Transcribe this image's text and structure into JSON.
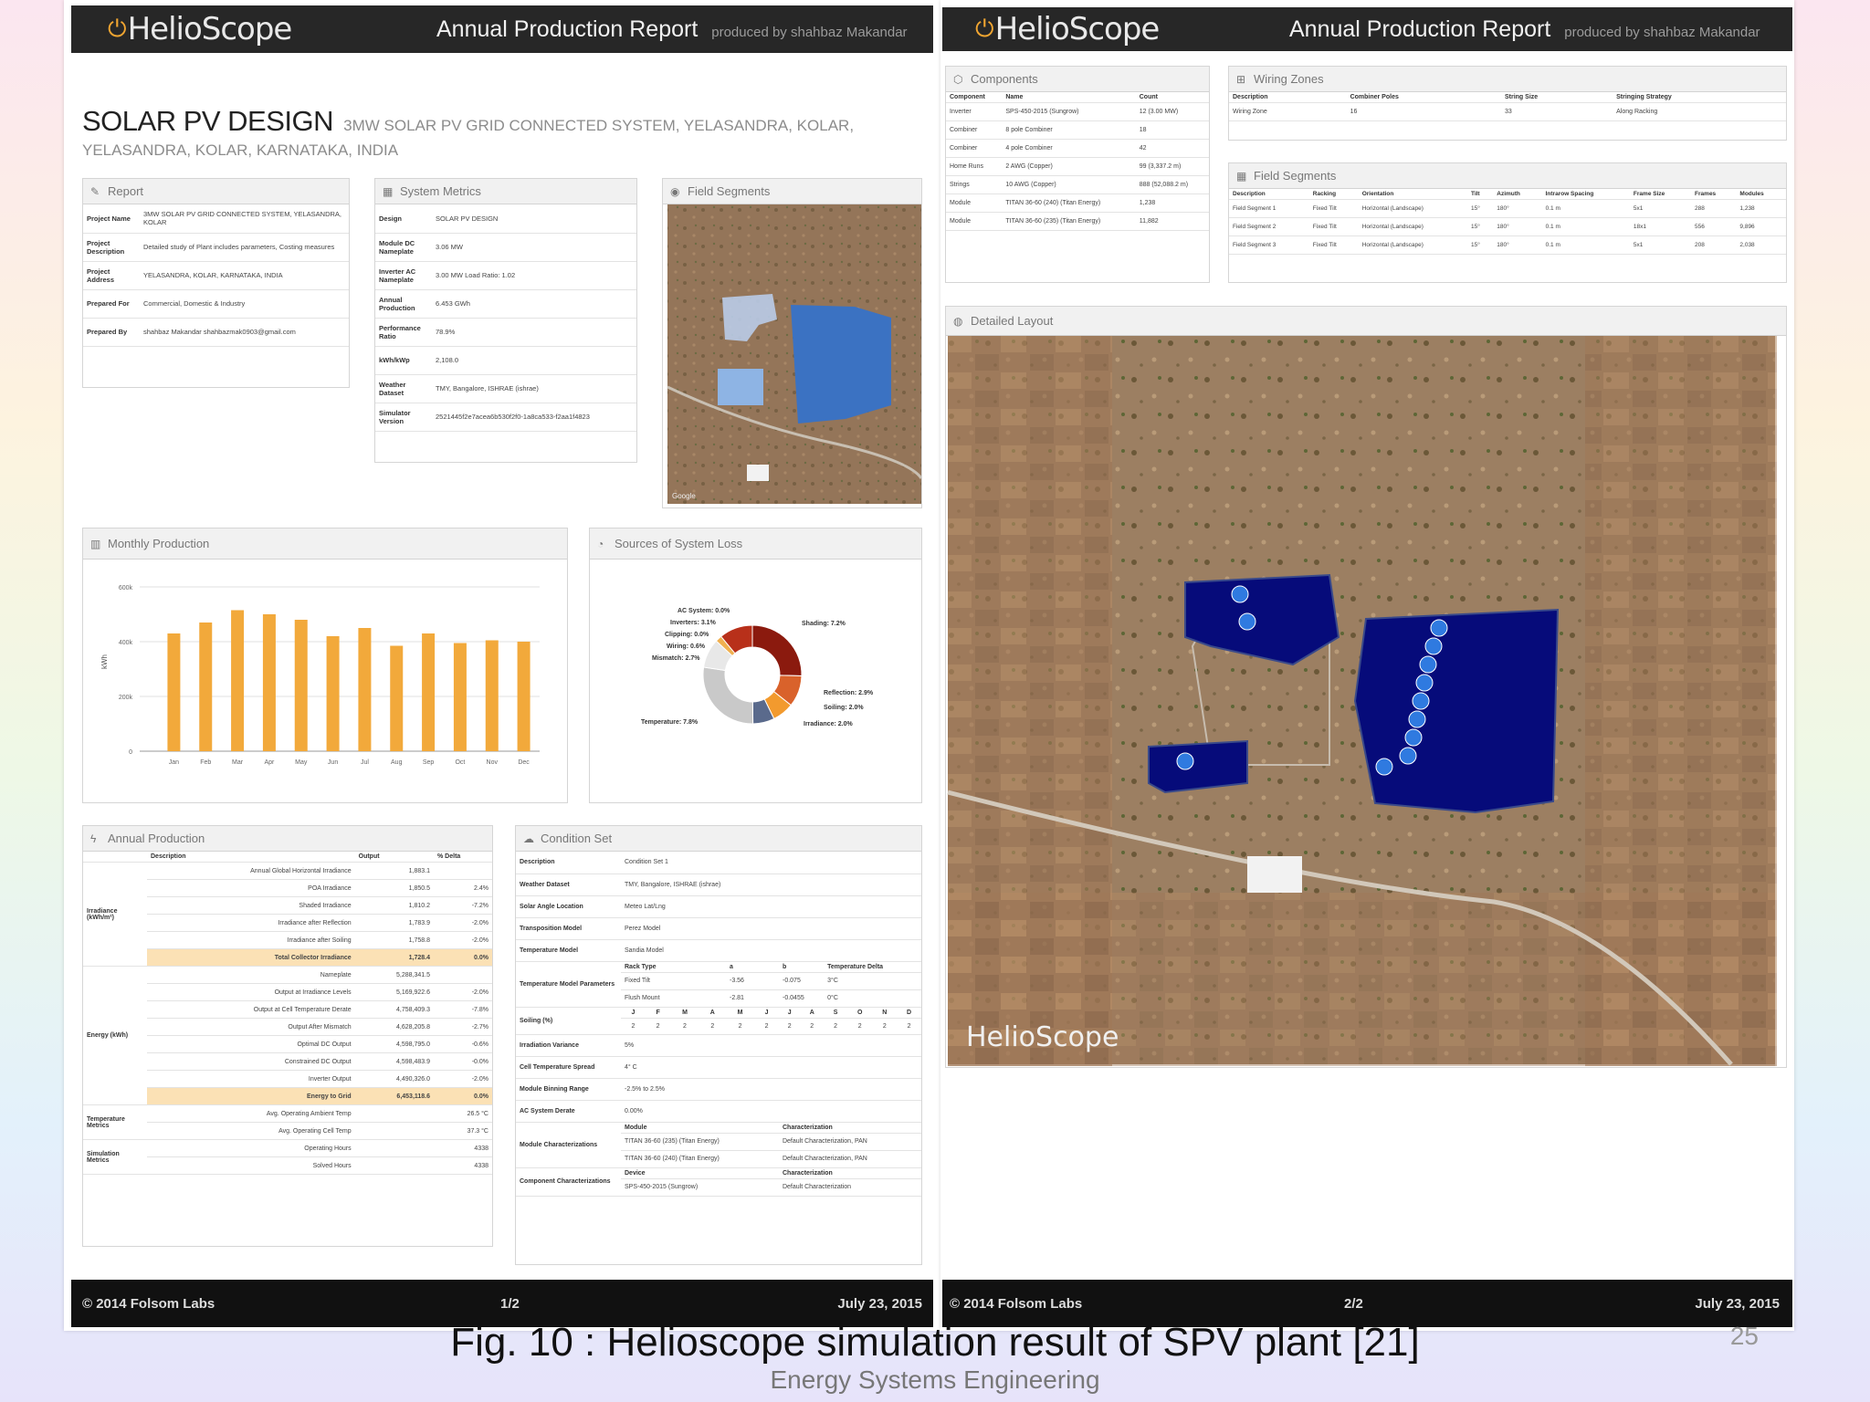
{
  "page1": {
    "header": {
      "logo": "HelioScope",
      "title": "Annual Production Report",
      "subtitle": "produced by shahbaz Makandar"
    },
    "design_title": "SOLAR PV DESIGN",
    "design_subtitle": "3MW SOLAR PV GRID CONNECTED SYSTEM, YELASANDRA, KOLAR,",
    "design_subtitle2": "YELASANDRA, KOLAR, KARNATAKA, INDIA",
    "report": {
      "heading": "Report",
      "rows": [
        {
          "k": "Project Name",
          "v": "3MW SOLAR PV GRID CONNECTED SYSTEM, YELASANDRA, KOLAR"
        },
        {
          "k": "Project Description",
          "v": "Detailed study of Plant includes parameters, Costing measures"
        },
        {
          "k": "Project Address",
          "v": "YELASANDRA, KOLAR, KARNATAKA, INDIA"
        },
        {
          "k": "Prepared For",
          "v": "Commercial, Domestic & Industry"
        },
        {
          "k": "Prepared By",
          "v": "shahbaz Makandar shahbazmak0903@gmail.com"
        }
      ]
    },
    "metrics": {
      "heading": "System Metrics",
      "rows": [
        {
          "k": "Design",
          "v": "SOLAR PV DESIGN"
        },
        {
          "k": "Module DC Nameplate",
          "v": "3.06 MW"
        },
        {
          "k": "Inverter AC Nameplate",
          "v": "3.00 MW Load Ratio: 1.02"
        },
        {
          "k": "Annual Production",
          "v": "6.453 GWh"
        },
        {
          "k": "Performance Ratio",
          "v": "78.9%"
        },
        {
          "k": "kWh/kWp",
          "v": "2,108.0"
        },
        {
          "k": "Weather Dataset",
          "v": "TMY, Bangalore, ISHRAE (ishrae)"
        },
        {
          "k": "Simulator Version",
          "v": "2521445f2e7acea6b530f2f0-1a8ca533-f2aa1f4823"
        }
      ]
    },
    "field_segments_heading": "Field Segments",
    "monthly": {
      "heading": "Monthly Production",
      "ylabel": "kWh",
      "ticks": [
        "600k",
        "400k",
        "200k",
        "0"
      ]
    },
    "losses": {
      "heading": "Sources of System Loss",
      "labels": [
        {
          "text": "AC System: 0.0%",
          "side": "left"
        },
        {
          "text": "Inverters: 3.1%",
          "side": "left"
        },
        {
          "text": "Clipping: 0.0%",
          "side": "left"
        },
        {
          "text": "Wiring: 0.6%",
          "side": "left"
        },
        {
          "text": "Mismatch: 2.7%",
          "side": "left"
        },
        {
          "text": "Temperature: 7.8%",
          "side": "left"
        },
        {
          "text": "Shading: 7.2%",
          "side": "right"
        },
        {
          "text": "Reflection: 2.9%",
          "side": "right"
        },
        {
          "text": "Soiling: 2.0%",
          "side": "right"
        },
        {
          "text": "Irradiance: 2.0%",
          "side": "right"
        }
      ]
    },
    "annual": {
      "heading": "Annual Production",
      "cols": [
        "",
        "Description",
        "Output",
        "% Delta"
      ],
      "irr_group": "Irradiance (kWh/m²)",
      "irr_rows": [
        {
          "d": "Annual Global Horizontal Irradiance",
          "o": "1,883.1",
          "p": ""
        },
        {
          "d": "POA Irradiance",
          "o": "1,850.5",
          "p": "2.4%"
        },
        {
          "d": "Shaded Irradiance",
          "o": "1,810.2",
          "p": "-7.2%"
        },
        {
          "d": "Irradiance after Reflection",
          "o": "1,783.9",
          "p": "-2.0%"
        },
        {
          "d": "Irradiance after Soiling",
          "o": "1,758.8",
          "p": "-2.0%"
        },
        {
          "d": "Total Collector Irradiance",
          "o": "1,728.4",
          "p": "0.0%",
          "hl": true
        }
      ],
      "energy_group": "Energy (kWh)",
      "energy_rows": [
        {
          "d": "Nameplate",
          "o": "5,288,341.5",
          "p": ""
        },
        {
          "d": "Output at Irradiance Levels",
          "o": "5,169,922.6",
          "p": "-2.0%"
        },
        {
          "d": "Output at Cell Temperature Derate",
          "o": "4,758,409.3",
          "p": "-7.8%"
        },
        {
          "d": "Output After Mismatch",
          "o": "4,628,205.8",
          "p": "-2.7%"
        },
        {
          "d": "Optimal DC Output",
          "o": "4,598,795.0",
          "p": "-0.6%"
        },
        {
          "d": "Constrained DC Output",
          "o": "4,598,483.9",
          "p": "-0.0%"
        },
        {
          "d": "Inverter Output",
          "o": "4,490,326.0",
          "p": "-2.0%"
        },
        {
          "d": "Energy to Grid",
          "o": "6,453,118.6",
          "p": "0.0%",
          "hl": true
        }
      ],
      "temp_group": "Temperature Metrics",
      "temp_rows": [
        {
          "d": "Avg. Operating Ambient Temp",
          "o": "",
          "p": "26.5 °C"
        },
        {
          "d": "Avg. Operating Cell Temp",
          "o": "",
          "p": "37.3 °C"
        }
      ],
      "sim_group": "Simulation Metrics",
      "sim_rows": [
        {
          "d": "Operating Hours",
          "o": "",
          "p": "4338"
        },
        {
          "d": "Solved Hours",
          "o": "",
          "p": "4338"
        }
      ]
    },
    "condition": {
      "heading": "Condition Set",
      "rows1": [
        {
          "k": "Description",
          "v": "Condition Set 1"
        },
        {
          "k": "Weather Dataset",
          "v": "TMY, Bangalore, ISHRAE (ishrae)"
        },
        {
          "k": "Solar Angle Location",
          "v": "Meteo Lat/Lng"
        },
        {
          "k": "Transposition Model",
          "v": "Perez Model"
        },
        {
          "k": "Temperature Model",
          "v": "Sandia Model"
        }
      ],
      "temp_param_label": "Temperature Model Parameters",
      "temp_param_head": [
        "Rack Type",
        "a",
        "b",
        "Temperature Delta"
      ],
      "temp_param_rows": [
        [
          "Fixed Tilt",
          "-3.56",
          "-0.075",
          "3°C"
        ],
        [
          "Flush Mount",
          "-2.81",
          "-0.0455",
          "0°C"
        ]
      ],
      "soiling_label": "Soiling (%)",
      "soiling_months": [
        "J",
        "F",
        "M",
        "A",
        "M",
        "J",
        "J",
        "A",
        "S",
        "O",
        "N",
        "D"
      ],
      "soiling_values": [
        "2",
        "2",
        "2",
        "2",
        "2",
        "2",
        "2",
        "2",
        "2",
        "2",
        "2",
        "2"
      ],
      "rows2": [
        {
          "k": "Irradiation Variance",
          "v": "5%"
        },
        {
          "k": "Cell Temperature Spread",
          "v": "4° C"
        },
        {
          "k": "Module Binning Range",
          "v": "-2.5% to 2.5%"
        },
        {
          "k": "AC System Derate",
          "v": "0.00%"
        }
      ],
      "module_char_label": "Module Characterizations",
      "module_char_head": [
        "Module",
        "Characterization"
      ],
      "module_char_rows": [
        [
          "TITAN 36-60 (235) (Titan Energy)",
          "Default Characterization, PAN"
        ],
        [
          "TITAN 36-60 (240) (Titan Energy)",
          "Default Characterization, PAN"
        ]
      ],
      "comp_char_label": "Component Characterizations",
      "comp_char_head": [
        "Device",
        "Characterization"
      ],
      "comp_char_rows": [
        [
          "SPS-450-2015 (Sungrow)",
          "Default Characterization"
        ]
      ]
    },
    "footer": {
      "left": "© 2014 Folsom Labs",
      "mid": "1/2",
      "right": "July 23, 2015"
    }
  },
  "page2": {
    "header": {
      "logo": "HelioScope",
      "title": "Annual Production Report",
      "subtitle": "produced by shahbaz Makandar"
    },
    "components": {
      "heading": "Components",
      "cols": [
        "Component",
        "Name",
        "Count"
      ],
      "rows": [
        [
          "Inverter",
          "SPS-450-2015 (Sungrow)",
          "12 (3.00 MW)"
        ],
        [
          "Combiner",
          "8 pole Combiner",
          "18"
        ],
        [
          "Combiner",
          "4 pole Combiner",
          "42"
        ],
        [
          "Home Runs",
          "2 AWG (Copper)",
          "99 (3,337.2 m)"
        ],
        [
          "Strings",
          "10 AWG (Copper)",
          "888 (52,088.2 m)"
        ],
        [
          "Module",
          "TITAN 36-60 (240) (Titan Energy)",
          "1,238"
        ],
        [
          "Module",
          "TITAN 36-60 (235) (Titan Energy)",
          "11,882"
        ]
      ]
    },
    "wiring": {
      "heading": "Wiring Zones",
      "cols": [
        "Description",
        "Combiner Poles",
        "String Size",
        "Stringing Strategy"
      ],
      "rows": [
        [
          "Wiring Zone",
          "16",
          "33",
          "Along Racking"
        ]
      ]
    },
    "segments": {
      "heading": "Field Segments",
      "cols": [
        "Description",
        "Racking",
        "Orientation",
        "Tilt",
        "Azimuth",
        "Intrarow Spacing",
        "Frame Size",
        "Frames",
        "Modules"
      ],
      "rows": [
        [
          "Field Segment 1",
          "Fixed Tilt",
          "Horizontal (Landscape)",
          "15°",
          "180°",
          "0.1 m",
          "5x1",
          "288",
          "1,238"
        ],
        [
          "Field Segment 2",
          "Fixed Tilt",
          "Horizontal (Landscape)",
          "15°",
          "180°",
          "0.1 m",
          "18x1",
          "556",
          "9,896"
        ],
        [
          "Field Segment 3",
          "Fixed Tilt",
          "Horizontal (Landscape)",
          "15°",
          "180°",
          "0.1 m",
          "5x1",
          "208",
          "2,038"
        ]
      ]
    },
    "layout_heading": "Detailed Layout",
    "map_watermark": "HelioScope",
    "footer": {
      "left": "© 2014 Folsom Labs",
      "mid": "2/2",
      "right": "July 23, 2015"
    }
  },
  "caption": "Fig. 10 : Helioscope simulation result of SPV plant [21]",
  "caption_sub": "Energy Systems Engineering",
  "slide_number": "25",
  "chart_data": [
    {
      "type": "bar",
      "categories": [
        "Jan",
        "Feb",
        "Mar",
        "Apr",
        "May",
        "Jun",
        "Jul",
        "Aug",
        "Sep",
        "Oct",
        "Nov",
        "Dec"
      ],
      "values": [
        430,
        470,
        515,
        500,
        480,
        420,
        450,
        385,
        430,
        395,
        405,
        400
      ],
      "title": "",
      "ylabel": "kWh",
      "ylim": [
        0,
        600
      ],
      "color": "#f2a93b"
    },
    {
      "type": "pie",
      "donut": true,
      "labels": [
        "Shading",
        "Reflection",
        "Soiling",
        "Irradiance",
        "Temperature",
        "Mismatch",
        "Wiring",
        "Clipping",
        "Inverters",
        "AC System"
      ],
      "values": [
        7.2,
        2.9,
        2.0,
        2.0,
        7.8,
        2.7,
        0.6,
        0.0,
        3.1,
        0.0
      ],
      "colors": [
        "#8b1a0e",
        "#d9622b",
        "#f29a2e",
        "#5a6a8c",
        "#c9c9c9",
        "#e8e8e8",
        "#f0b050",
        "#d0d0d0",
        "#b8301a",
        "#999999"
      ]
    }
  ]
}
